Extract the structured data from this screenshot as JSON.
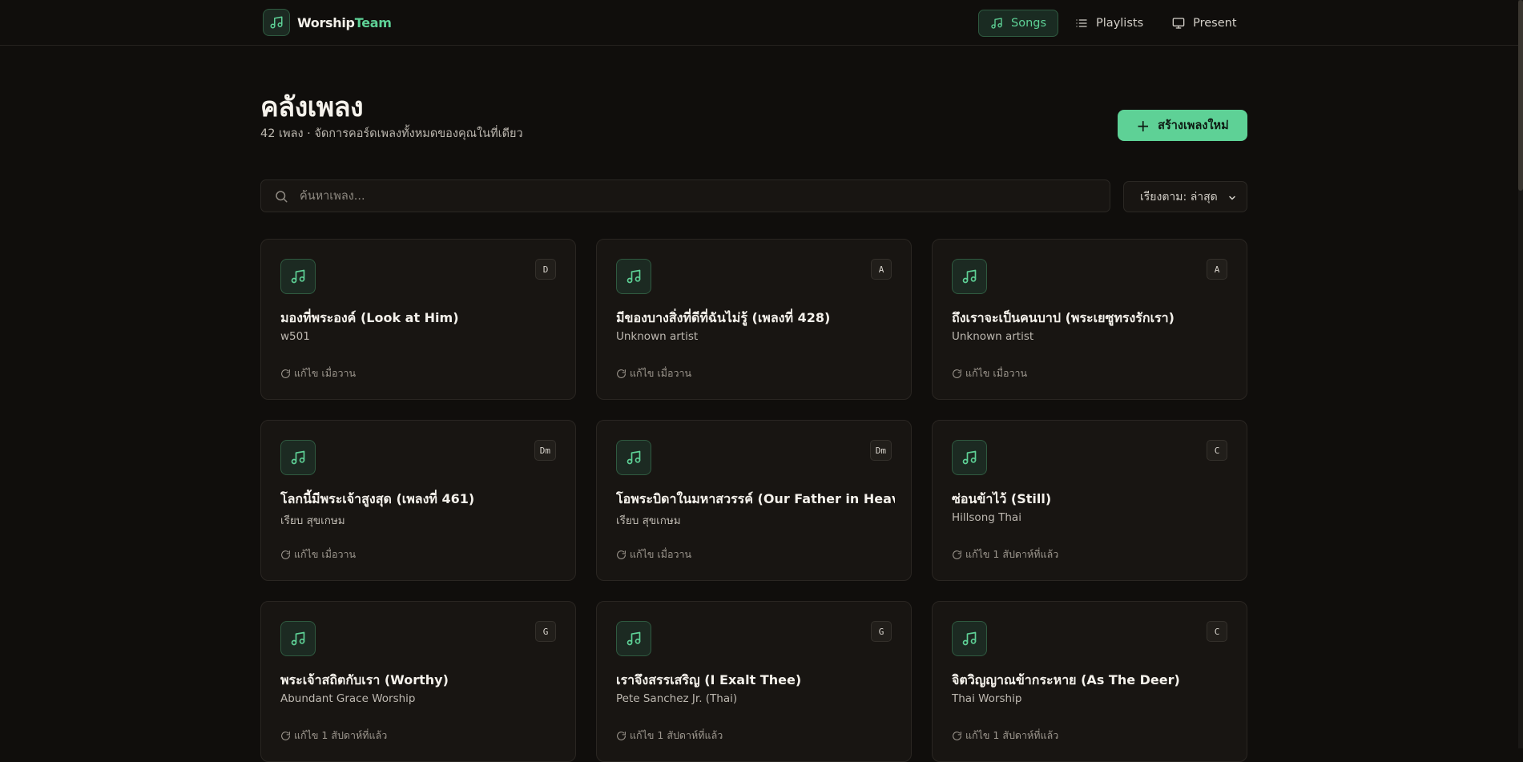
{
  "brand": {
    "name_a": "Worship",
    "name_b": "Team"
  },
  "nav": [
    {
      "label": "Songs",
      "icon": "music-note-icon",
      "active": true
    },
    {
      "label": "Playlists",
      "icon": "list-icon",
      "active": false
    },
    {
      "label": "Present",
      "icon": "monitor-icon",
      "active": false
    }
  ],
  "page": {
    "title": "คลังเพลง",
    "subtitle": "42 เพลง · จัดการคอร์ดเพลงทั้งหมดของคุณในที่เดียว",
    "create_label": "สร้างเพลงใหม่"
  },
  "search": {
    "placeholder": "ค้นหาเพลง..."
  },
  "sort": {
    "label": "เรียงตาม: ล่าสุด"
  },
  "songs": [
    {
      "title": "มองที่พระองค์ (Look at Him)",
      "artist": "w501",
      "key": "D",
      "edited": "แก้ไข เมื่อวาน"
    },
    {
      "title": "มีของบางสิ่งที่ดีที่ฉันไม่รู้ (เพลงที่ 428)",
      "artist": "Unknown artist",
      "key": "A",
      "edited": "แก้ไข เมื่อวาน"
    },
    {
      "title": "ถึงเราจะเป็นคนบาป (พระเยซูทรงรักเรา)",
      "artist": "Unknown artist",
      "key": "A",
      "edited": "แก้ไข เมื่อวาน"
    },
    {
      "title": "โลกนี้มีพระเจ้าสูงสุด (เพลงที่ 461)",
      "artist": "เรียบ สุขเกษม",
      "key": "Dm",
      "edited": "แก้ไข เมื่อวาน"
    },
    {
      "title": "โอพระบิดาในมหาสวรรค์ (Our Father in Heaven)",
      "artist": "เรียบ สุขเกษม",
      "key": "Dm",
      "edited": "แก้ไข เมื่อวาน"
    },
    {
      "title": "ซ่อนข้าไว้ (Still)",
      "artist": "Hillsong Thai",
      "key": "C",
      "edited": "แก้ไข 1 สัปดาห์ที่แล้ว"
    },
    {
      "title": "พระเจ้าสถิตกับเรา (Worthy)",
      "artist": "Abundant Grace Worship",
      "key": "G",
      "edited": "แก้ไข 1 สัปดาห์ที่แล้ว"
    },
    {
      "title": "เราจึงสรรเสริญ (I Exalt Thee)",
      "artist": "Pete Sanchez Jr. (Thai)",
      "key": "G",
      "edited": "แก้ไข 1 สัปดาห์ที่แล้ว"
    },
    {
      "title": "จิตวิญญาณข้ากระหาย (As The Deer)",
      "artist": "Thai Worship",
      "key": "C",
      "edited": "แก้ไข 1 สัปดาห์ที่แล้ว"
    }
  ],
  "colors": {
    "accent": "#5ed196",
    "background": "#100e0c",
    "card": "#181512"
  }
}
